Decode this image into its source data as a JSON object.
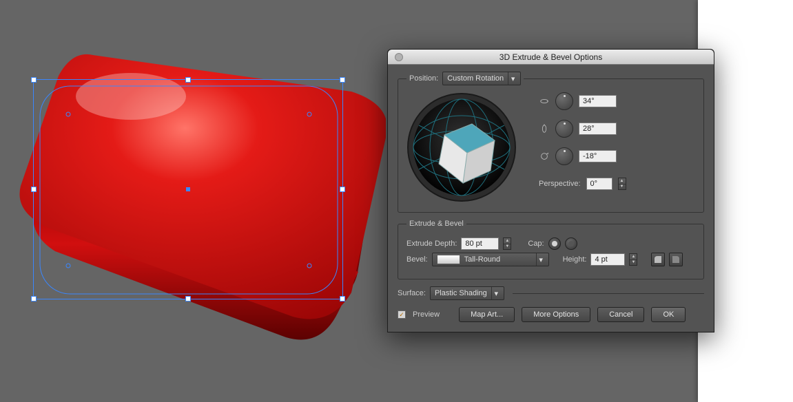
{
  "dialog": {
    "title": "3D Extrude & Bevel Options",
    "position_label": "Position:",
    "position_value": "Custom Rotation",
    "angles": {
      "x": "34°",
      "y": "28°",
      "z": "-18°"
    },
    "perspective_label": "Perspective:",
    "perspective_value": "0°",
    "extrude_legend": "Extrude & Bevel",
    "extrude_depth_label": "Extrude Depth:",
    "extrude_depth_value": "80 pt",
    "cap_label": "Cap:",
    "bevel_label": "Bevel:",
    "bevel_value": "Tall-Round",
    "height_label": "Height:",
    "height_value": "4 pt",
    "surface_label": "Surface:",
    "surface_value": "Plastic Shading",
    "preview_label": "Preview",
    "preview_checked": true,
    "buttons": {
      "map_art": "Map Art...",
      "more": "More Options",
      "cancel": "Cancel",
      "ok": "OK"
    }
  },
  "colors": {
    "object_fill": "#c30d0d",
    "cube_top": "#4ea6ba",
    "cube_left": "#e8e8e8",
    "cube_right": "#cfcfcf"
  }
}
